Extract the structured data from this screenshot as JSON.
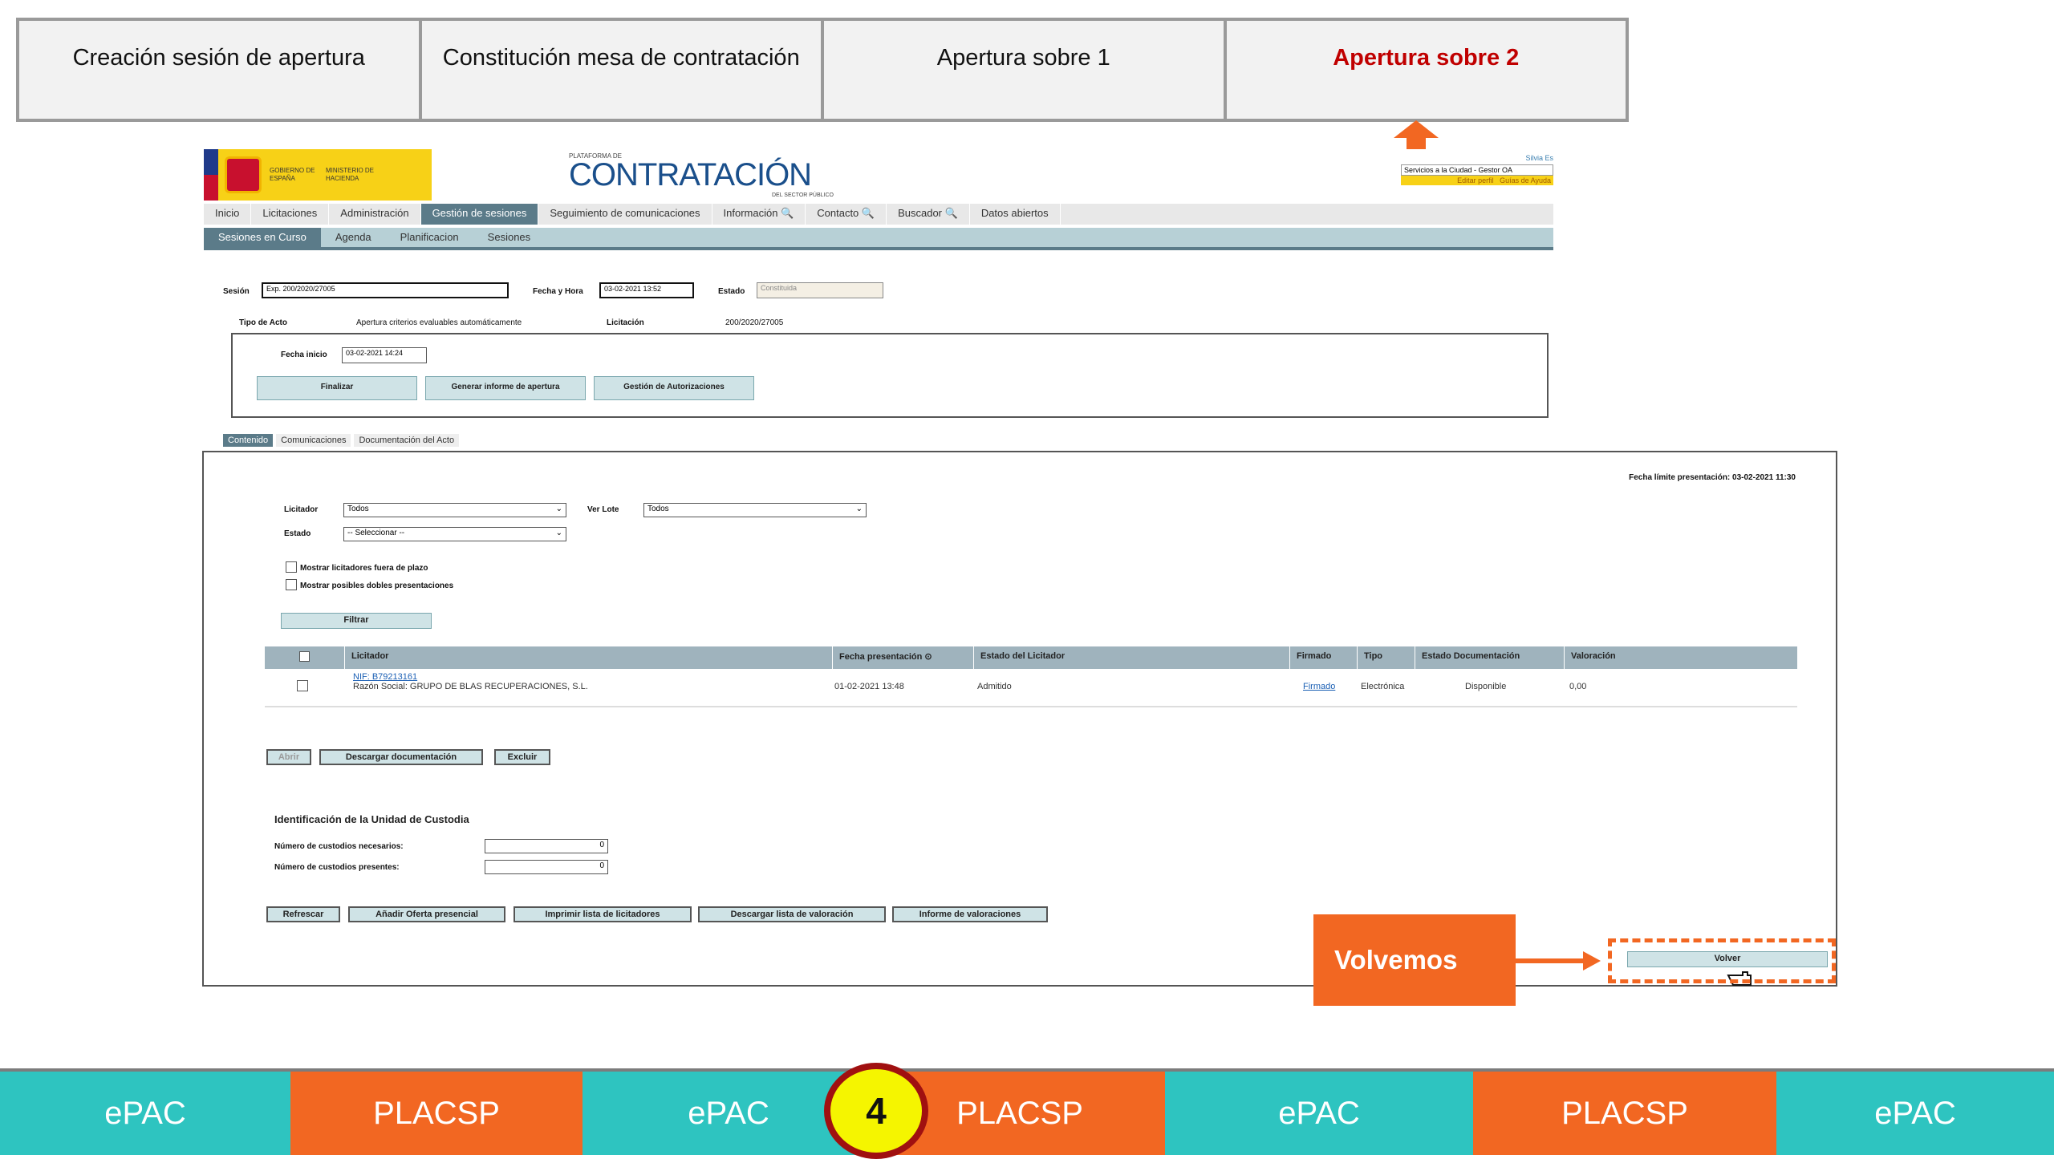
{
  "steps": [
    {
      "label": "Creación sesión de apertura",
      "active": false
    },
    {
      "label": "Constitución mesa de contratación",
      "active": false
    },
    {
      "label": "Apertura sobre 1",
      "active": false
    },
    {
      "label": "Apertura sobre 2",
      "active": true
    }
  ],
  "header": {
    "gov_line1": "GOBIERNO DE ESPAÑA",
    "gov_line2": "MINISTERIO DE HACIENDA",
    "brand_small": "PLATAFORMA DE",
    "brand_big": "CONTRATACIÓN",
    "brand_sub": "DEL SECTOR PÚBLICO",
    "user_name": "Silvia Es",
    "user_role": "Servicios a la Ciudad - Gestor OA",
    "edit_profile": "Editar perfil",
    "help_guides": "Guías de Ayuda"
  },
  "nav": [
    "Inicio",
    "Licitaciones",
    "Administración",
    "Gestión de sesiones",
    "Seguimiento de comunicaciones",
    "Información 🔍",
    "Contacto 🔍",
    "Buscador 🔍",
    "Datos abiertos"
  ],
  "nav_selected": 3,
  "subnav": [
    "Sesiones en Curso",
    "Agenda",
    "Planificacion",
    "Sesiones"
  ],
  "session": {
    "sesion_label": "Sesión",
    "sesion_value": "Exp. 200/2020/27005",
    "fecha_label": "Fecha y Hora",
    "fecha_value": "03-02-2021 13:52",
    "estado_label": "Estado",
    "estado_value": "Constituida",
    "tipo_label": "Tipo de Acto",
    "tipo_value": "Apertura criterios evaluables automáticamente",
    "licit_label": "Licitación",
    "licit_value": "200/2020/27005",
    "inicio_label": "Fecha inicio",
    "inicio_value": "03-02-2021 14:24",
    "btn_finalizar": "Finalizar",
    "btn_informe": "Generar informe de apertura",
    "btn_autorizaciones": "Gestión de Autorizaciones"
  },
  "tabs": [
    "Contenido",
    "Comunicaciones",
    "Documentación del Acto"
  ],
  "main": {
    "deadline": "Fecha límite presentación: 03-02-2021 11:30",
    "licitador_label": "Licitador",
    "licitador_value": "Todos",
    "lote_label": "Ver Lote",
    "lote_value": "Todos",
    "estado_label": "Estado",
    "estado_value": "-- Seleccionar --",
    "chk_fuera": "Mostrar licitadores fuera de plazo",
    "chk_dobles": "Mostrar posibles dobles presentaciones",
    "btn_filtrar": "Filtrar",
    "columns": [
      "",
      "Licitador",
      "Fecha presentación ⊙",
      "Estado del Licitador",
      "Firmado",
      "Tipo",
      "Estado Documentación",
      "Valoración"
    ],
    "row": {
      "nif": "NIF: B79213161",
      "razon": "Razón Social: GRUPO DE BLAS RECUPERACIONES, S.L.",
      "fecha": "01-02-2021 13:48",
      "estado": "Admitido",
      "firmado": "Firmado",
      "tipo": "Electrónica",
      "doc": "Disponible",
      "valoracion": "0,00"
    },
    "btn_abrir": "Abrir",
    "btn_descargar": "Descargar documentación",
    "btn_excluir": "Excluir",
    "custodia_title": "Identificación de la Unidad de Custodia",
    "custodios_nec_label": "Número de custodios necesarios:",
    "custodios_nec_value": "0",
    "custodios_pres_label": "Número de custodios presentes:",
    "custodios_pres_value": "0",
    "btn_refrescar": "Refrescar",
    "btn_anadir": "Añadir Oferta presencial",
    "btn_imprimir": "Imprimir lista de licitadores",
    "btn_descargar_val": "Descargar lista de valoración",
    "btn_informe_val": "Informe de valoraciones",
    "btn_volver": "Volver"
  },
  "callout": "Volvemos",
  "bottom": [
    "ePAC",
    "PLACSP",
    "ePAC",
    "PLACSP",
    "ePAC",
    "PLACSP",
    "ePAC"
  ],
  "badge": "4",
  "colors": {
    "orange": "#f26722",
    "teal": "#2ec4c0",
    "active_red": "#c00000",
    "badge_yellow": "#f5f500"
  }
}
